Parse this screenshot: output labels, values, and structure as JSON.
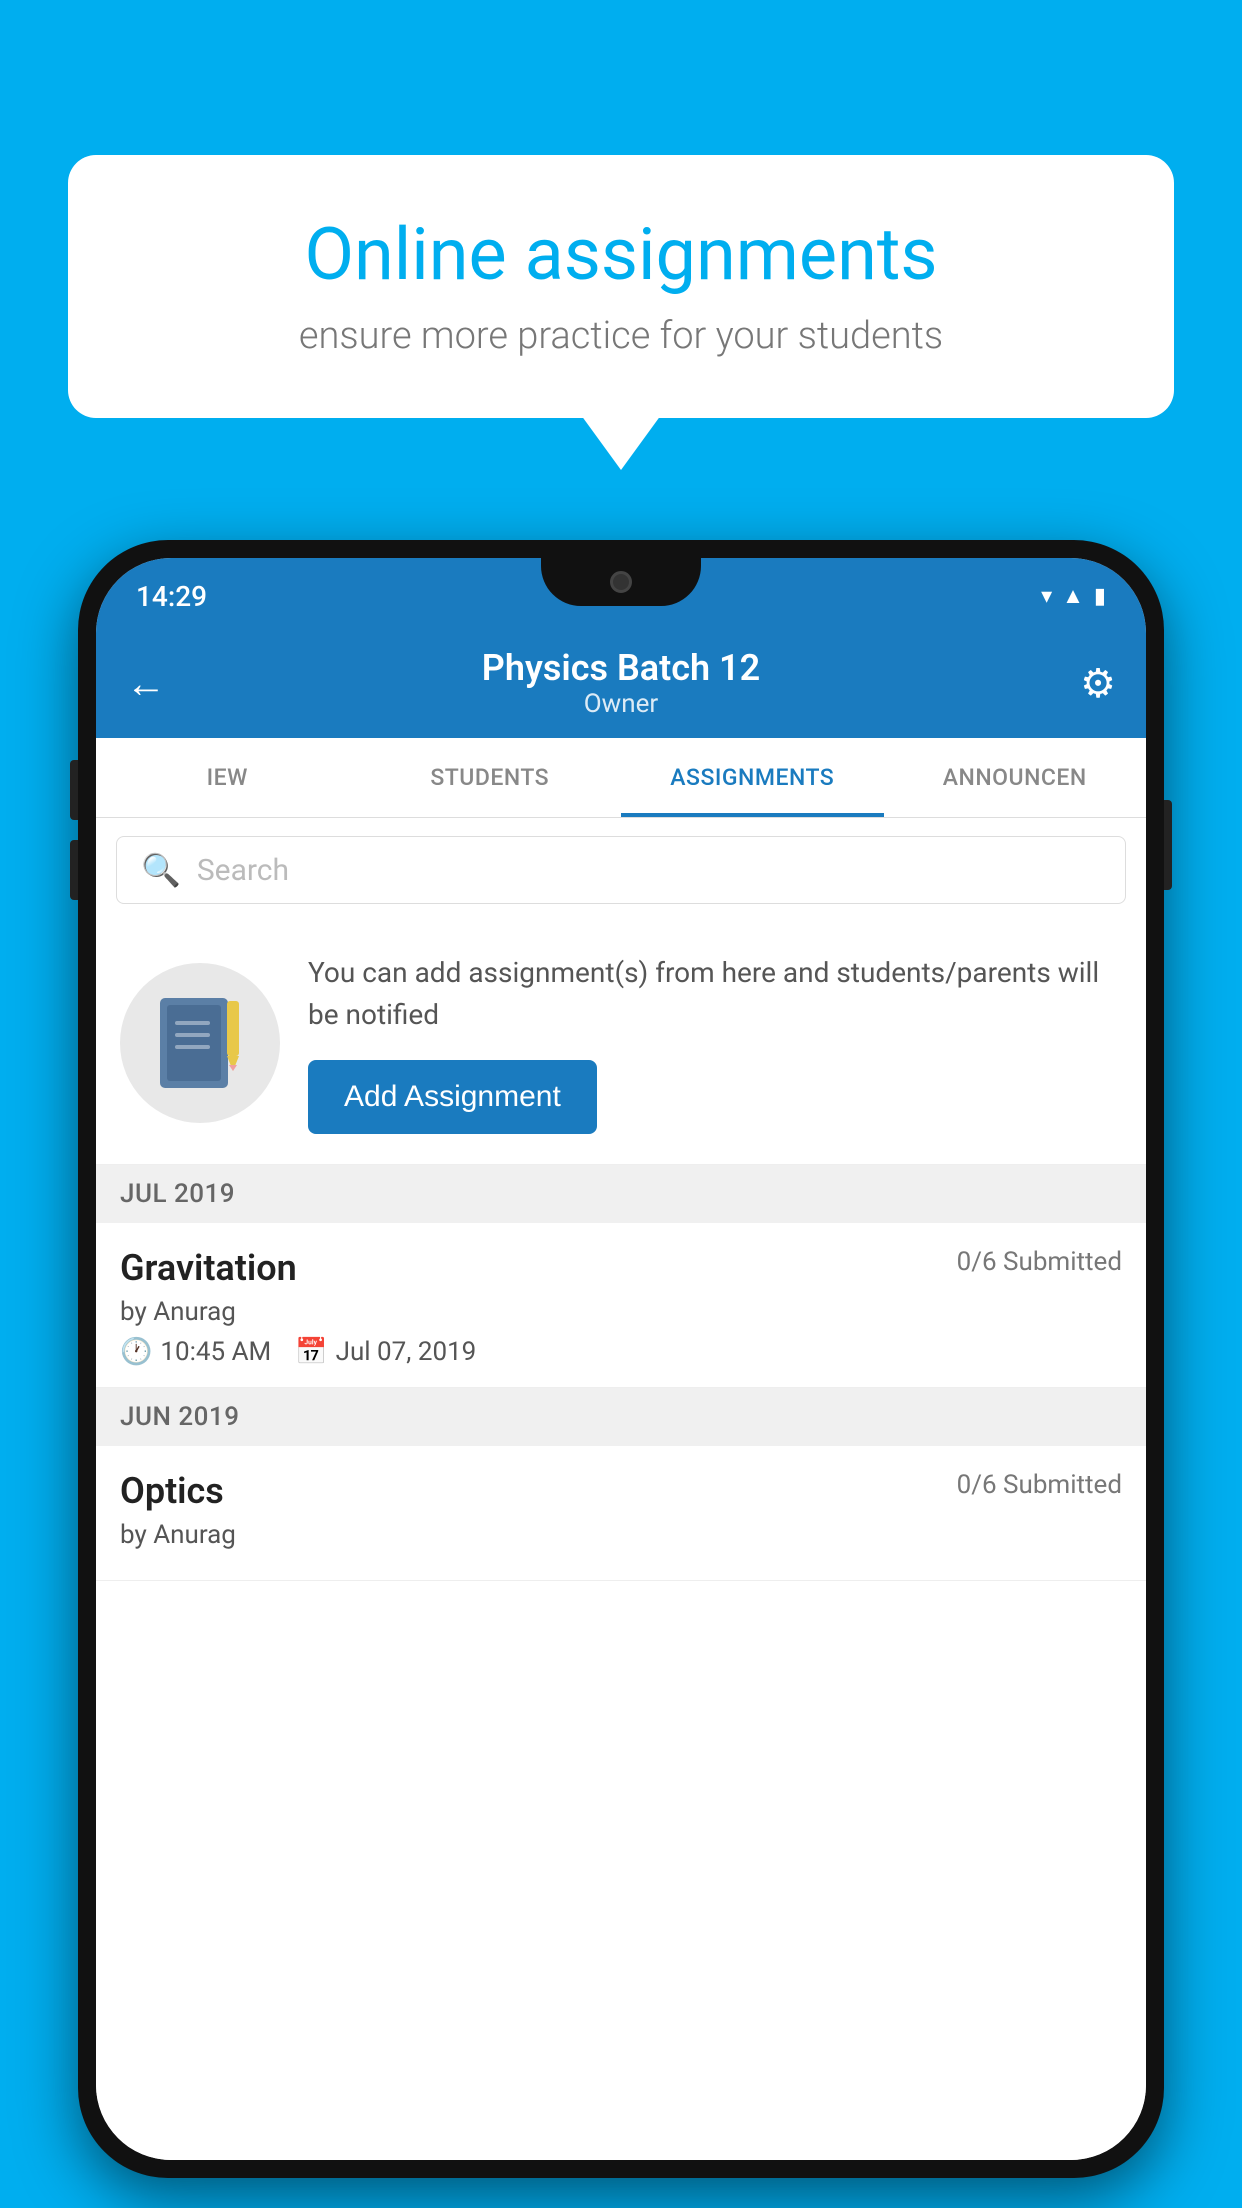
{
  "background_color": "#00AEEF",
  "speech_bubble": {
    "title": "Online assignments",
    "subtitle": "ensure more practice for your students"
  },
  "status_bar": {
    "time": "14:29",
    "icons": [
      "wifi",
      "signal",
      "battery"
    ]
  },
  "header": {
    "title": "Physics Batch 12",
    "subtitle": "Owner",
    "back_label": "←",
    "gear_label": "⚙"
  },
  "tabs": [
    {
      "label": "IEW",
      "active": false
    },
    {
      "label": "STUDENTS",
      "active": false
    },
    {
      "label": "ASSIGNMENTS",
      "active": true
    },
    {
      "label": "ANNOUNCEN",
      "active": false
    }
  ],
  "search": {
    "placeholder": "Search"
  },
  "info_card": {
    "description": "You can add assignment(s) from here and students/parents will be notified",
    "button_label": "Add Assignment"
  },
  "sections": [
    {
      "header": "JUL 2019",
      "assignments": [
        {
          "title": "Gravitation",
          "submitted": "0/6 Submitted",
          "author": "by Anurag",
          "time": "10:45 AM",
          "date": "Jul 07, 2019"
        }
      ]
    },
    {
      "header": "JUN 2019",
      "assignments": [
        {
          "title": "Optics",
          "submitted": "0/6 Submitted",
          "author": "by Anurag",
          "time": "",
          "date": ""
        }
      ]
    }
  ]
}
